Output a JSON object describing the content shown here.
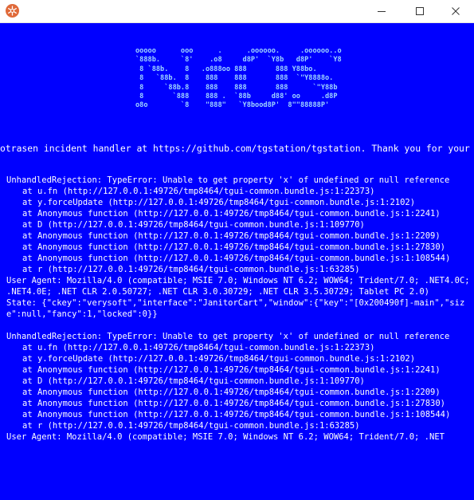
{
  "window": {
    "buttons": {
      "minimize": "minimize",
      "maximize": "maximize",
      "close": "close"
    }
  },
  "logo_ascii": "ooooo      ooo      .      .oooooo.     .oooooo..o\n`888b.     `8'    .o8     d8P'  `Y8b   d8P'    `Y8\n 8 `88b.    8   .o888oo 888       888 Y88bo.\n 8   `88b.  8    888    888       888  `\"Y8888o.\n 8     `88b.8    888    888       888      `\"Y88b\n 8       `888    888 .  `88b     d88' oo     .d8P\no8o        `8    \"888\"   `Y8bood8P'  8\"\"88888P'",
  "intro_text": "otrasen incident handler at https://github.com/tgstation/tgstation. Thank you for your c",
  "errors": [
    {
      "heading": "UnhandledRejection: TypeError: Unable to get property 'x' of undefined or null reference",
      "stack": [
        "at u.fn (http://127.0.0.1:49726/tmp8464/tgui-common.bundle.js:1:22373)",
        "at y.forceUpdate (http://127.0.0.1:49726/tmp8464/tgui-common.bundle.js:1:2102)",
        "at Anonymous function (http://127.0.0.1:49726/tmp8464/tgui-common.bundle.js:1:2241)",
        "at D (http://127.0.0.1:49726/tmp8464/tgui-common.bundle.js:1:109770)",
        "at Anonymous function (http://127.0.0.1:49726/tmp8464/tgui-common.bundle.js:1:2209)",
        "at Anonymous function (http://127.0.0.1:49726/tmp8464/tgui-common.bundle.js:1:27830)",
        "at Anonymous function (http://127.0.0.1:49726/tmp8464/tgui-common.bundle.js:1:108544)",
        "at r (http://127.0.0.1:49726/tmp8464/tgui-common.bundle.js:1:63285)"
      ],
      "user_agent": "User Agent: Mozilla/4.0 (compatible; MSIE 7.0; Windows NT 6.2; WOW64; Trident/7.0; .NET4.0C; .NET4.0E; .NET CLR 2.0.50727; .NET CLR 3.0.30729; .NET CLR 3.5.30729; Tablet PC 2.0)",
      "state": "State: {\"ckey\":\"verysoft\",\"interface\":\"JanitorCart\",\"window\":{\"key\":\"[0x200490f]-main\",\"size\":null,\"fancy\":1,\"locked\":0}}"
    },
    {
      "heading": "UnhandledRejection: TypeError: Unable to get property 'x' of undefined or null reference",
      "stack": [
        "at u.fn (http://127.0.0.1:49726/tmp8464/tgui-common.bundle.js:1:22373)",
        "at y.forceUpdate (http://127.0.0.1:49726/tmp8464/tgui-common.bundle.js:1:2102)",
        "at Anonymous function (http://127.0.0.1:49726/tmp8464/tgui-common.bundle.js:1:2241)",
        "at D (http://127.0.0.1:49726/tmp8464/tgui-common.bundle.js:1:109770)",
        "at Anonymous function (http://127.0.0.1:49726/tmp8464/tgui-common.bundle.js:1:2209)",
        "at Anonymous function (http://127.0.0.1:49726/tmp8464/tgui-common.bundle.js:1:27830)",
        "at Anonymous function (http://127.0.0.1:49726/tmp8464/tgui-common.bundle.js:1:108544)",
        "at r (http://127.0.0.1:49726/tmp8464/tgui-common.bundle.js:1:63285)"
      ],
      "user_agent": "User Agent: Mozilla/4.0 (compatible; MSIE 7.0; Windows NT 6.2; WOW64; Trident/7.0; .NET",
      "state": ""
    }
  ],
  "colors": {
    "background": "#0000ff",
    "logo": "#9ed4ff",
    "text": "#ffffff",
    "app_icon": "#e06a3a"
  }
}
